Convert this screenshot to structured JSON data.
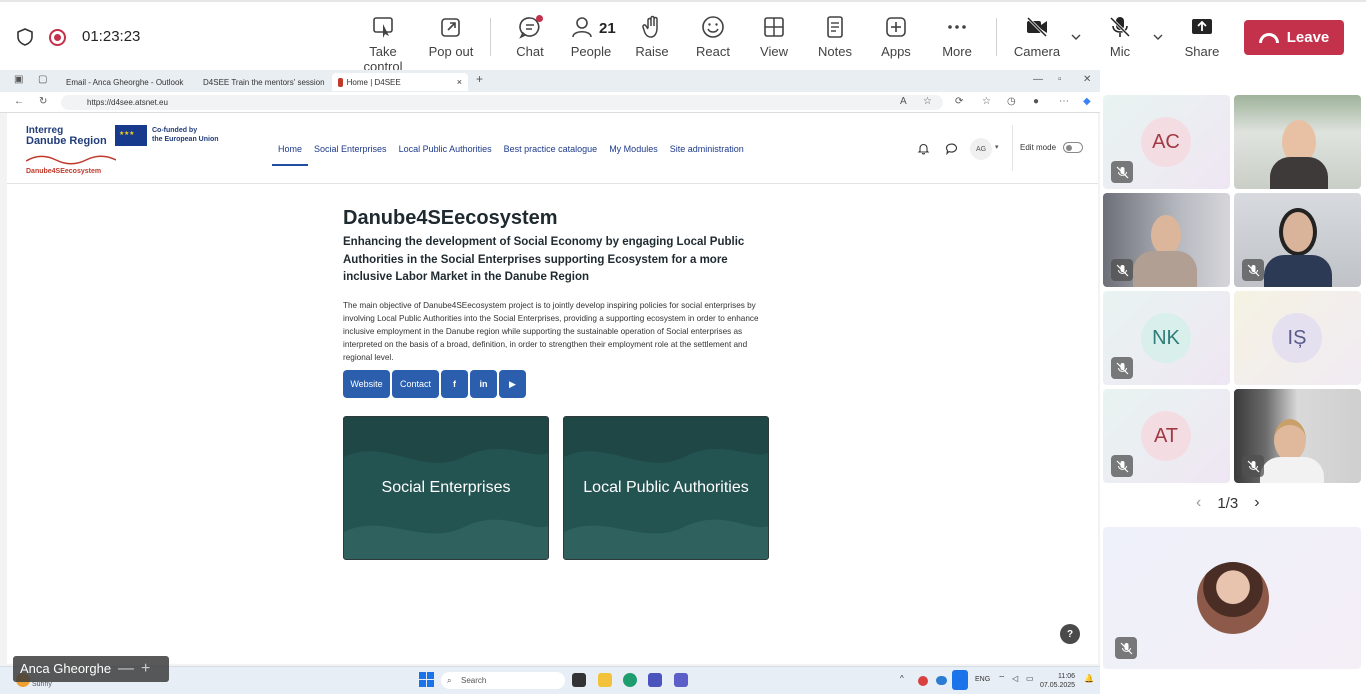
{
  "meeting": {
    "timer": "01:23:23",
    "toolbar": [
      {
        "label": "Take control",
        "icon": "take-control-icon"
      },
      {
        "label": "Pop out",
        "icon": "pop-out-icon"
      },
      {
        "label": "Chat",
        "icon": "chat-icon"
      },
      {
        "label": "People",
        "icon": "people-icon",
        "count": "21"
      },
      {
        "label": "Raise",
        "icon": "raise-hand-icon"
      },
      {
        "label": "React",
        "icon": "react-icon"
      },
      {
        "label": "View",
        "icon": "view-icon"
      },
      {
        "label": "Notes",
        "icon": "notes-icon"
      },
      {
        "label": "Apps",
        "icon": "apps-icon"
      },
      {
        "label": "More",
        "icon": "more-icon"
      },
      {
        "label": "Camera",
        "icon": "camera-off-icon"
      },
      {
        "label": "Mic",
        "icon": "mic-off-icon"
      },
      {
        "label": "Share",
        "icon": "share-icon"
      }
    ],
    "leave_label": "Leave",
    "leave_color": "#c4314b",
    "presenter_name": "Anca Gheorghe"
  },
  "browser": {
    "tabs": [
      {
        "title": "Email - Anca Gheorghe - Outlook"
      },
      {
        "title": "D4SEE Train the mentors' session"
      },
      {
        "title": "Home | D4SEE"
      }
    ],
    "new_tab": "+",
    "url": "https://d4see.atsnet.eu"
  },
  "site": {
    "logo": {
      "line1": "Interreg",
      "line2": "Danube Region",
      "cofunded1": "Co-funded by",
      "cofunded2": "the European Union",
      "brand": "Danube4SEecosystem"
    },
    "nav": [
      "Home",
      "Social Enterprises",
      "Local Public Authorities",
      "Best practice catalogue",
      "My Modules",
      "Site administration"
    ],
    "user_initials": "AG",
    "edit_mode_label": "Edit mode",
    "title": "Danube4SEecosystem",
    "subtitle": "Enhancing the development of Social Economy by engaging Local Public Authorities in the Social Enterprises supporting Ecosystem for a more inclusive Labor Market in the Danube Region",
    "description": "The main objective of Danube4SEecosystem project is to jointly develop inspiring policies for social enterprises by involving Local Public Authorities into the Social Enterprises, providing a supporting ecosystem in order to enhance inclusive employment in the Danube region while supporting the sustainable operation of Social enterprises as interpreted on the basis of a broad, definition, in order to strengthen their employment role at the settlement and regional level.",
    "buttons": {
      "website": "Website",
      "contact": "Contact",
      "facebook": "f",
      "linkedin": "in",
      "youtube": "▶"
    },
    "cards": [
      "Social Enterprises",
      "Local Public Authorities"
    ],
    "card_color": "#245452",
    "help": "?"
  },
  "taskbar": {
    "search_placeholder": "Search",
    "weather": "Sunny",
    "lang": "ENG",
    "time": "11:06",
    "date": "07.05.2025"
  },
  "participants": {
    "tiles": [
      {
        "initials": "AC",
        "color": "#a13a44",
        "bg": "#f3dde3"
      },
      {
        "initials": "NK",
        "color": "#2f7d7a",
        "bg": "#d8efec"
      },
      {
        "initials": "IȘ",
        "color": "#5a5a8a",
        "bg": "#e4e0f0"
      },
      {
        "initials": "AT",
        "color": "#a13a44",
        "bg": "#f3dde3"
      }
    ],
    "page": "1/3"
  }
}
